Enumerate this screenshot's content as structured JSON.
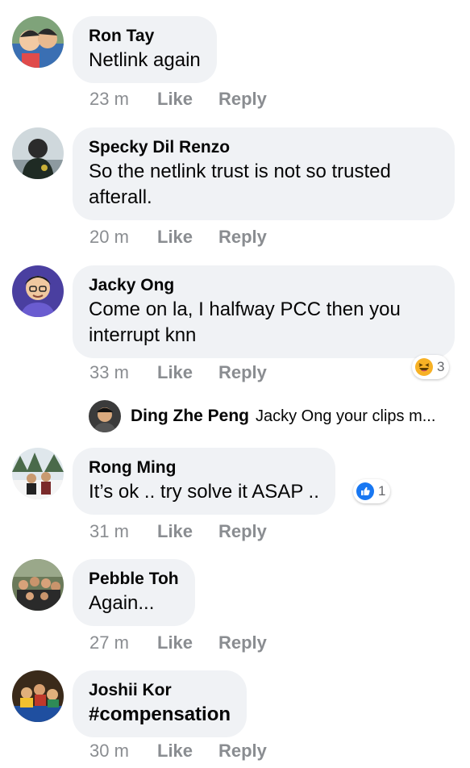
{
  "colors": {
    "bubble": "#f0f2f5",
    "meta_text": "#8a8d91",
    "like_blue": "#1877f2",
    "haha_yellow": "#f7b125"
  },
  "comments": [
    {
      "name": "Ron Tay",
      "text": [
        "Netlink again"
      ],
      "time": "23 m",
      "like": "Like",
      "reply": "Reply"
    },
    {
      "name": "Specky Dil Renzo",
      "text": [
        "So the netlink trust is not so trusted",
        "afterall."
      ],
      "time": "20 m",
      "like": "Like",
      "reply": "Reply"
    },
    {
      "name": "Jacky Ong",
      "text": [
        "Come on la, I halfway PCC then you",
        "interrupt knn"
      ],
      "time": "33 m",
      "like": "Like",
      "reply": "Reply",
      "reaction": {
        "icon": "haha-icon",
        "count": "3"
      }
    },
    {
      "name": "Rong Ming",
      "text": [
        "It’s ok .. try solve it ASAP .."
      ],
      "time": "31 m",
      "like": "Like",
      "reply": "Reply",
      "reaction": {
        "icon": "like-icon",
        "count": "1"
      }
    },
    {
      "name": "Pebble Toh",
      "text": [
        "Again..."
      ],
      "time": "27 m",
      "like": "Like",
      "reply": "Reply"
    },
    {
      "name": "Joshii Kor",
      "text": [
        "#compensation"
      ],
      "time": "30 m",
      "like": "Like",
      "reply": "Reply"
    }
  ],
  "reply_preview": {
    "name": "Ding Zhe Peng",
    "text": "Jacky Ong your clips m..."
  }
}
